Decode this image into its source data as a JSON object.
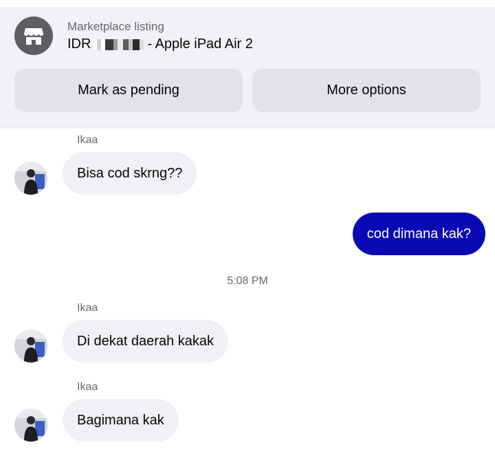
{
  "listing": {
    "label": "Marketplace listing",
    "price_prefix": "IDR",
    "title_suffix": "- Apple iPad Air 2",
    "shop_icon": "storefront-icon"
  },
  "actions": {
    "mark_pending": "Mark as pending",
    "more_options": "More options"
  },
  "conversation": {
    "messages": [
      {
        "sender": "Ikaa",
        "text": "Bisa cod skrng??",
        "direction": "incoming"
      },
      {
        "text": "cod dimana kak?",
        "direction": "outgoing"
      },
      {
        "sender": "Ikaa",
        "text": "Di dekat daerah kakak",
        "direction": "incoming"
      },
      {
        "sender": "Ikaa",
        "text": "Bagimana kak",
        "direction": "incoming"
      }
    ],
    "timestamp": "5:08 PM"
  },
  "colors": {
    "outgoing_bubble": "#0a0ab5",
    "incoming_bubble": "#f0f1f4",
    "header_background": "#f1f2f6",
    "button_background": "#e1e3e8"
  }
}
